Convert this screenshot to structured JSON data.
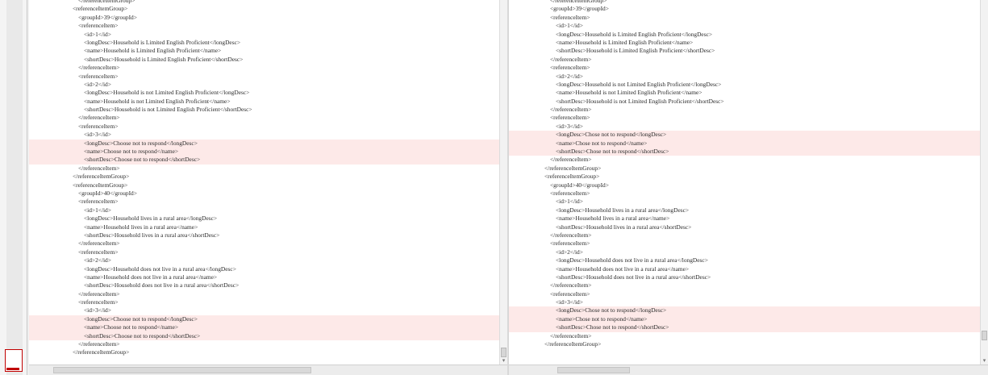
{
  "left": {
    "lines": [
      {
        "indent": 3,
        "text": "</referenceItemGroup>",
        "diff": false
      },
      {
        "indent": 2,
        "text": "<referenceItemGroup>",
        "diff": false
      },
      {
        "indent": 3,
        "text": "<groupId>39</groupId>",
        "diff": false
      },
      {
        "indent": 3,
        "text": "<referenceItem>",
        "diff": false
      },
      {
        "indent": 4,
        "text": "<id>1</id>",
        "diff": false
      },
      {
        "indent": 4,
        "text": "<longDesc>Household is Limited English Proficient</longDesc>",
        "diff": false
      },
      {
        "indent": 4,
        "text": "<name>Household is Limited English Proficient</name>",
        "diff": false
      },
      {
        "indent": 4,
        "text": "<shortDesc>Household is Limited English Proficient</shortDesc>",
        "diff": false
      },
      {
        "indent": 3,
        "text": "</referenceItem>",
        "diff": false
      },
      {
        "indent": 3,
        "text": "<referenceItem>",
        "diff": false
      },
      {
        "indent": 4,
        "text": "<id>2</id>",
        "diff": false
      },
      {
        "indent": 4,
        "text": "<longDesc>Household is not Limited English Proficient</longDesc>",
        "diff": false
      },
      {
        "indent": 4,
        "text": "<name>Household is not Limited English Proficient</name>",
        "diff": false
      },
      {
        "indent": 4,
        "text": "<shortDesc>Household is not Limited English Proficient</shortDesc>",
        "diff": false
      },
      {
        "indent": 3,
        "text": "</referenceItem>",
        "diff": false
      },
      {
        "indent": 3,
        "text": "<referenceItem>",
        "diff": false
      },
      {
        "indent": 4,
        "text": "<id>3</id>",
        "diff": false
      },
      {
        "indent": 4,
        "text": "<longDesc>Choose not to respond</longDesc>",
        "diff": true
      },
      {
        "indent": 4,
        "text": "<name>Choose not to respond</name>",
        "diff": true
      },
      {
        "indent": 4,
        "text": "<shortDesc>Choose not to respond</shortDesc>",
        "diff": true
      },
      {
        "indent": 3,
        "text": "</referenceItem>",
        "diff": false
      },
      {
        "indent": 2,
        "text": "</referenceItemGroup>",
        "diff": false
      },
      {
        "indent": 2,
        "text": "<referenceItemGroup>",
        "diff": false
      },
      {
        "indent": 3,
        "text": "<groupId>40</groupId>",
        "diff": false
      },
      {
        "indent": 3,
        "text": "<referenceItem>",
        "diff": false
      },
      {
        "indent": 4,
        "text": "<id>1</id>",
        "diff": false
      },
      {
        "indent": 4,
        "text": "<longDesc>Household lives in a rural area</longDesc>",
        "diff": false
      },
      {
        "indent": 4,
        "text": "<name>Household lives in a rural area</name>",
        "diff": false
      },
      {
        "indent": 4,
        "text": "<shortDesc>Household lives in a rural area</shortDesc>",
        "diff": false
      },
      {
        "indent": 3,
        "text": "</referenceItem>",
        "diff": false
      },
      {
        "indent": 3,
        "text": "<referenceItem>",
        "diff": false
      },
      {
        "indent": 4,
        "text": "<id>2</id>",
        "diff": false
      },
      {
        "indent": 4,
        "text": "<longDesc>Household does not live in a rural area</longDesc>",
        "diff": false
      },
      {
        "indent": 4,
        "text": "<name>Household does not live in a rural area</name>",
        "diff": false
      },
      {
        "indent": 4,
        "text": "<shortDesc>Household does not live in a rural area</shortDesc>",
        "diff": false
      },
      {
        "indent": 3,
        "text": "</referenceItem>",
        "diff": false
      },
      {
        "indent": 3,
        "text": "<referenceItem>",
        "diff": false
      },
      {
        "indent": 4,
        "text": "<id>3</id>",
        "diff": false
      },
      {
        "indent": 4,
        "text": "<longDesc>Choose not to respond</longDesc>",
        "diff": true
      },
      {
        "indent": 4,
        "text": "<name>Choose not to respond</name>",
        "diff": true
      },
      {
        "indent": 4,
        "text": "<shortDesc>Choose not to respond</shortDesc>",
        "diff": true
      },
      {
        "indent": 3,
        "text": "</referenceItem>",
        "diff": false
      },
      {
        "indent": 2,
        "text": "</referenceItemGroup>",
        "diff": false
      }
    ]
  },
  "right": {
    "lines": [
      {
        "indent": 3,
        "text": "</referenceItemGroup>",
        "diff": false
      },
      {
        "indent": 3,
        "text": "<groupId>39</groupId>",
        "diff": false
      },
      {
        "indent": 3,
        "text": "<referenceItem>",
        "diff": false
      },
      {
        "indent": 4,
        "text": "<id>1</id>",
        "diff": false
      },
      {
        "indent": 4,
        "text": "<longDesc>Household is Limited English Proficient</longDesc>",
        "diff": false
      },
      {
        "indent": 4,
        "text": "<name>Household is Limited English Proficient</name>",
        "diff": false
      },
      {
        "indent": 4,
        "text": "<shortDesc>Household is Limited English Proficient</shortDesc>",
        "diff": false
      },
      {
        "indent": 3,
        "text": "</referenceItem>",
        "diff": false
      },
      {
        "indent": 3,
        "text": "<referenceItem>",
        "diff": false
      },
      {
        "indent": 4,
        "text": "<id>2</id>",
        "diff": false
      },
      {
        "indent": 4,
        "text": "<longDesc>Household is not Limited English Proficient</longDesc>",
        "diff": false
      },
      {
        "indent": 4,
        "text": "<name>Household is not Limited English Proficient</name>",
        "diff": false
      },
      {
        "indent": 4,
        "text": "<shortDesc>Household is not Limited English Proficient</shortDesc>",
        "diff": false
      },
      {
        "indent": 3,
        "text": "</referenceItem>",
        "diff": false
      },
      {
        "indent": 3,
        "text": "<referenceItem>",
        "diff": false
      },
      {
        "indent": 4,
        "text": "<id>3</id>",
        "diff": false
      },
      {
        "indent": 4,
        "text": "<longDesc>Chose not to respond</longDesc>",
        "diff": true
      },
      {
        "indent": 4,
        "text": "<name>Chose not to respond</name>",
        "diff": true
      },
      {
        "indent": 4,
        "text": "<shortDesc>Chose not to respond</shortDesc>",
        "diff": true
      },
      {
        "indent": 3,
        "text": "</referenceItem>",
        "diff": false
      },
      {
        "indent": 2,
        "text": "</referenceItemGroup>",
        "diff": false
      },
      {
        "indent": 2,
        "text": "<referenceItemGroup>",
        "diff": false
      },
      {
        "indent": 3,
        "text": "<groupId>40</groupId>",
        "diff": false
      },
      {
        "indent": 3,
        "text": "<referenceItem>",
        "diff": false
      },
      {
        "indent": 4,
        "text": "<id>1</id>",
        "diff": false
      },
      {
        "indent": 4,
        "text": "<longDesc>Household lives in a rural area</longDesc>",
        "diff": false
      },
      {
        "indent": 4,
        "text": "<name>Household lives in a rural area</name>",
        "diff": false
      },
      {
        "indent": 4,
        "text": "<shortDesc>Household lives in a rural area</shortDesc>",
        "diff": false
      },
      {
        "indent": 3,
        "text": "</referenceItem>",
        "diff": false
      },
      {
        "indent": 3,
        "text": "<referenceItem>",
        "diff": false
      },
      {
        "indent": 4,
        "text": "<id>2</id>",
        "diff": false
      },
      {
        "indent": 4,
        "text": "<longDesc>Household does not live in a rural area</longDesc>",
        "diff": false
      },
      {
        "indent": 4,
        "text": "<name>Household does not live in a rural area</name>",
        "diff": false
      },
      {
        "indent": 4,
        "text": "<shortDesc>Household does not live in a rural area</shortDesc>",
        "diff": false
      },
      {
        "indent": 3,
        "text": "</referenceItem>",
        "diff": false
      },
      {
        "indent": 3,
        "text": "<referenceItem>",
        "diff": false
      },
      {
        "indent": 4,
        "text": "<id>3</id>",
        "diff": false
      },
      {
        "indent": 4,
        "text": "<longDesc>Chose not to respond</longDesc>",
        "diff": true
      },
      {
        "indent": 4,
        "text": "<name>Chose not to respond</name>",
        "diff": true
      },
      {
        "indent": 4,
        "text": "<shortDesc>Chose not to respond</shortDesc>",
        "diff": true
      },
      {
        "indent": 3,
        "text": "</referenceItem>",
        "diff": false
      },
      {
        "indent": 2,
        "text": "</referenceItemGroup>",
        "diff": false
      }
    ]
  },
  "colors": {
    "diff_highlight": "#fde9e8",
    "overview_marker": "#c00000",
    "text": "#2a2a2a"
  },
  "icons": {
    "scroll_up": "up-arrow-icon",
    "scroll_down": "down-arrow-icon"
  }
}
